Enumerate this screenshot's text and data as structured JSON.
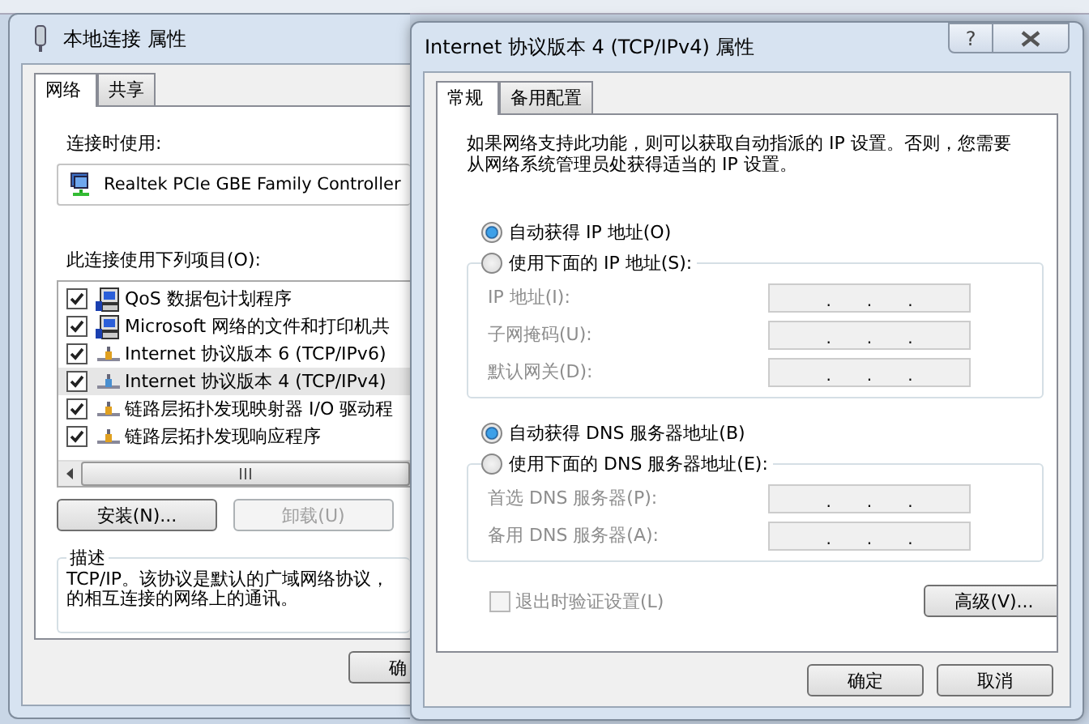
{
  "background_window": {
    "title": "本地连接 属性",
    "tabs": [
      {
        "label": "网络",
        "selected": true
      },
      {
        "label": "共享",
        "selected": false
      }
    ],
    "connect_using_label": "连接时使用:",
    "adapter": "Realtek PCIe GBE Family Controller",
    "items_label": "此连接使用下列项目(O):",
    "items": [
      {
        "kind": "service",
        "label": "QoS 数据包计划程序",
        "checked": true,
        "selected": false
      },
      {
        "kind": "service",
        "label": "Microsoft 网络的文件和打印机共",
        "checked": true,
        "selected": false
      },
      {
        "kind": "protocol",
        "label": "Internet 协议版本 6 (TCP/IPv6)",
        "checked": true,
        "selected": false
      },
      {
        "kind": "protocol",
        "label": "Internet 协议版本 4 (TCP/IPv4)",
        "checked": true,
        "selected": true
      },
      {
        "kind": "protocol",
        "label": "链路层拓扑发现映射器 I/O 驱动程",
        "checked": true,
        "selected": false
      },
      {
        "kind": "protocol",
        "label": "链路层拓扑发现响应程序",
        "checked": true,
        "selected": false
      }
    ],
    "buttons": [
      {
        "label": "安装(N)...",
        "disabled": false
      },
      {
        "label": "卸载(U)",
        "disabled": true
      }
    ],
    "description": {
      "title": "描述",
      "lines": [
        "TCP/IP。该协议是默认的广域网络协议，",
        "的相互连接的网络上的通讯。"
      ]
    },
    "footer_buttons": [
      "确"
    ]
  },
  "dialog": {
    "title": "Internet 协议版本 4 (TCP/IPv4) 属性",
    "help_button": "?",
    "tabs": [
      {
        "label": "常规",
        "selected": true
      },
      {
        "label": "备用配置",
        "selected": false
      }
    ],
    "intro": "如果网络支持此功能，则可以获取自动指派的 IP 设置。否则，您需要从网络系统管理员处获得适当的 IP 设置。",
    "ip_mode": [
      {
        "label": "自动获得 IP 地址(O)",
        "selected": true
      },
      {
        "label": "使用下面的 IP 地址(S):",
        "selected": false
      }
    ],
    "ip_fields": [
      {
        "label": "IP 地址(I):",
        "separators": [
          ".",
          ".",
          "."
        ],
        "disabled": true
      },
      {
        "label": "子网掩码(U):",
        "separators": [
          ".",
          ".",
          "."
        ],
        "disabled": true
      },
      {
        "label": "默认网关(D):",
        "separators": [
          ".",
          ".",
          "."
        ],
        "disabled": true
      }
    ],
    "dns_mode": [
      {
        "label": "自动获得 DNS 服务器地址(B)",
        "selected": true
      },
      {
        "label": "使用下面的 DNS 服务器地址(E):",
        "selected": false
      }
    ],
    "dns_fields": [
      {
        "label": "首选 DNS 服务器(P):",
        "separators": [
          ".",
          ".",
          "."
        ],
        "disabled": true
      },
      {
        "label": "备用 DNS 服务器(A):",
        "separators": [
          ".",
          ".",
          "."
        ],
        "disabled": true
      }
    ],
    "validate": {
      "label": "退出时验证设置(L)",
      "checked": false,
      "disabled": true
    },
    "advanced_button": "高级(V)...",
    "buttons": [
      "确定",
      "取消"
    ]
  }
}
